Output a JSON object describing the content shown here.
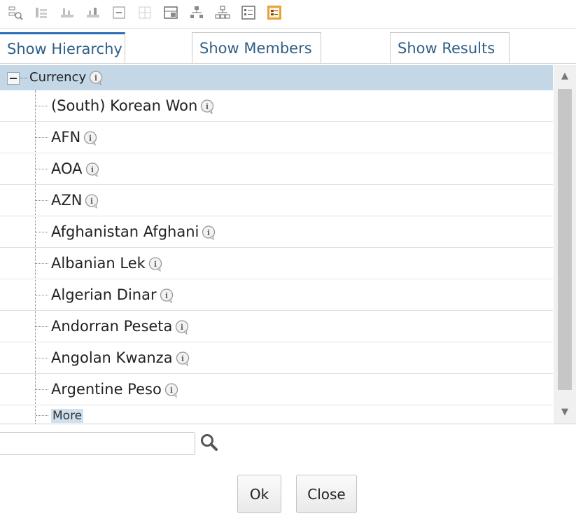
{
  "toolbar": {
    "icons": [
      "zoom-tree-icon",
      "expand-branch-icon",
      "collapse-branch-icon",
      "indent-icon",
      "collapse-all-icon",
      "expand-all-icon",
      "view-toggle-icon",
      "hierarchy-icon",
      "org-chart-icon",
      "list-view-icon",
      "properties-icon"
    ],
    "active_color": "#e8a23a"
  },
  "tabs": [
    {
      "label": "Show Hierarchy",
      "active": true
    },
    {
      "label": "Show Members",
      "active": false
    },
    {
      "label": "Show Results",
      "active": false
    }
  ],
  "tree": {
    "root": {
      "label": "Currency"
    },
    "items": [
      {
        "label": "(South) Korean Won"
      },
      {
        "label": "AFN"
      },
      {
        "label": "AOA"
      },
      {
        "label": "AZN"
      },
      {
        "label": "Afghanistan Afghani"
      },
      {
        "label": "Albanian Lek"
      },
      {
        "label": "Algerian Dinar"
      },
      {
        "label": "Andorran Peseta"
      },
      {
        "label": "Angolan Kwanza"
      },
      {
        "label": "Argentine Peso"
      }
    ],
    "more_label": "More",
    "selected_color": "#c3d7e7"
  },
  "search": {
    "value": "",
    "placeholder": ""
  },
  "buttons": {
    "ok": "Ok",
    "close": "Close"
  }
}
